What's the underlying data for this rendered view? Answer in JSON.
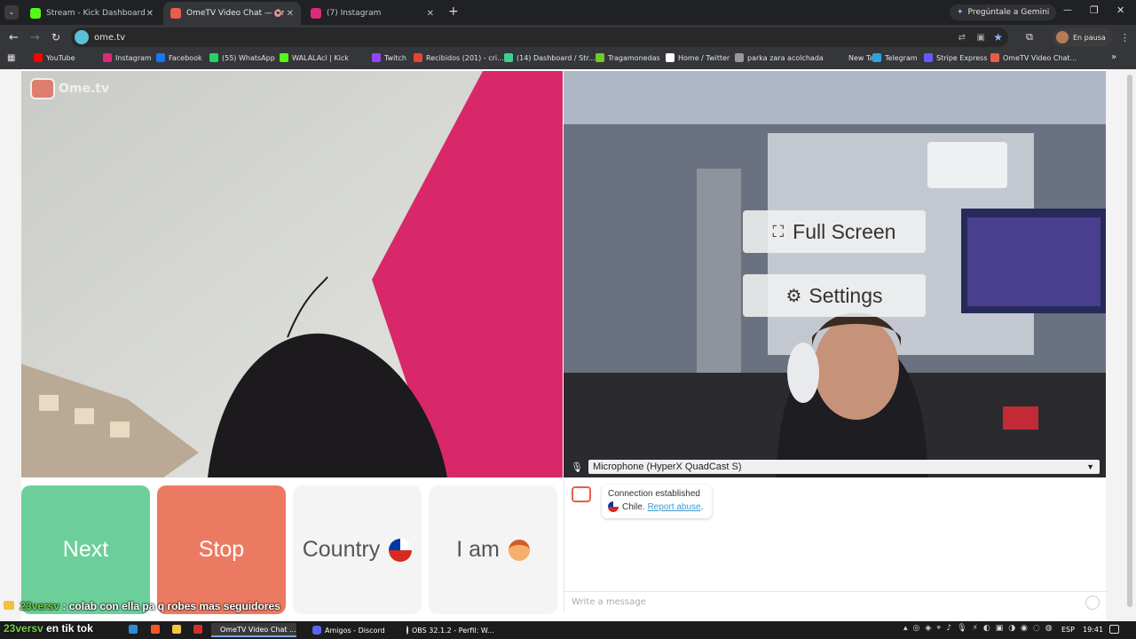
{
  "browser": {
    "tabs": [
      {
        "label": "Stream - Kick Dashboard",
        "fav_color": "#53fc18"
      },
      {
        "label": "OmeTV Video Chat — Ome",
        "fav_color": "#e85d4a"
      },
      {
        "label": "(7) Instagram",
        "fav_color": "#dd2a7b"
      }
    ],
    "gemini_label": "Pregúntale a Gemini",
    "url": "ome.tv",
    "profile_label": "En pausa",
    "bookmarks": [
      {
        "label": "YouTube",
        "color": "#ff0000"
      },
      {
        "label": "Instagram",
        "color": "#dd2a7b"
      },
      {
        "label": "Facebook",
        "color": "#1877f2"
      },
      {
        "label": "(55) WhatsApp",
        "color": "#25d366"
      },
      {
        "label": "WALALAcl | Kick",
        "color": "#53fc18"
      },
      {
        "label": "Twitch",
        "color": "#9146ff"
      },
      {
        "label": "Recibidos (201) - cri...",
        "color": "#ea4335"
      },
      {
        "label": "(14) Dashboard / Str...",
        "color": "#3ecf8e"
      },
      {
        "label": "Tragamonedas",
        "color": "#6ccc2a"
      },
      {
        "label": "Home / Twitter",
        "color": "#ffffff"
      },
      {
        "label": "parka zara acolchada",
        "color": "#999999"
      },
      {
        "label": "New Tab",
        "color": "#35363a"
      },
      {
        "label": "Telegram",
        "color": "#2aa3e0"
      },
      {
        "label": "Stripe Express",
        "color": "#635bff"
      },
      {
        "label": "OmeTV Video Chat...",
        "color": "#e85d4a"
      }
    ]
  },
  "ometv": {
    "logo_text": "Ome.tv",
    "overlay": {
      "fullscreen_label": "Full Screen",
      "settings_label": "Settings",
      "microphone_label": "Microphone (HyperX QuadCast S)"
    },
    "buttons": {
      "next_label": "Next",
      "stop_label": "Stop",
      "country_label": "Country",
      "iam_label": "I am"
    },
    "chat": {
      "connection_text": "Connection established",
      "country_name": "Chile.",
      "report_label": "Report abuse",
      "report_suffix": ".",
      "input_placeholder": "Write a message"
    },
    "stream_overlay": {
      "line1_user": "23versv",
      "line1_text": ": colab con ella pa q robes mas seguidores",
      "line2_user": "23versv",
      "line2_text": "en tik tok"
    }
  },
  "taskbar": {
    "items": [
      {
        "label": "OmeTV Video Chat ..."
      },
      {
        "label": "Amigos - Discord"
      },
      {
        "label": "OBS 32.1.2 - Perfil: W..."
      }
    ],
    "lang": "ESP",
    "time": "19:41"
  },
  "colors": {
    "next": "#6ccf9a",
    "stop": "#ec7a62",
    "link": "#3d9ad1"
  }
}
